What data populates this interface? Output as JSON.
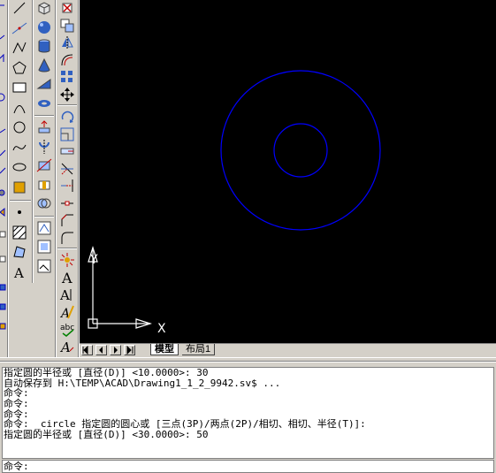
{
  "canvas": {
    "background": "#000000",
    "circle_color": "#0000ff",
    "ucs_color": "#ffffff",
    "ucs": {
      "x_label": "X",
      "y_label": "Y"
    }
  },
  "drawing": {
    "outer_circle_radius": 30,
    "inner_circle_radius": 10
  },
  "tabs": {
    "model": "模型",
    "layout1": "布局1"
  },
  "command": {
    "history": [
      "指定圆的半径或 [直径(D)] <10.0000>: 30",
      "自动保存到 H:\\TEMP\\ACAD\\Drawing1_1_2_9942.sv$ ...",
      "命令:",
      "命令:",
      "命令:",
      "命令: _circle 指定圆的圆心或 [三点(3P)/两点(2P)/相切、相切、半径(T)]:",
      "指定圆的半径或 [直径(D)] <30.0000>: 50"
    ],
    "prompt": "命令:"
  },
  "toolbars": {
    "draw": [
      "line-icon",
      "construction-line-icon",
      "polyline-icon",
      "polygon-icon",
      "rectangle-icon",
      "arc-icon",
      "circle-icon",
      "spline-icon",
      "ellipse-icon",
      "insert-block-icon",
      "point-icon",
      "hatch-icon",
      "region-icon",
      "text-icon"
    ],
    "modify": [
      "erase-icon",
      "copy-icon",
      "mirror-icon",
      "offset-icon",
      "array-icon",
      "move-icon",
      "rotate-icon",
      "scale-icon",
      "stretch-icon",
      "trim-icon",
      "extend-icon",
      "break-icon",
      "chamfer-icon",
      "fillet-icon",
      "explode-icon"
    ],
    "solids": [
      "box-icon",
      "sphere-icon",
      "cylinder-icon",
      "cone-icon",
      "wedge-icon",
      "torus-icon",
      "extrude-icon",
      "revolve-icon",
      "slice-icon",
      "section-icon",
      "interfere-icon",
      "setup-drawing-icon",
      "setup-view-icon",
      "setup-profile-icon"
    ],
    "text": [
      "multiline-text-icon",
      "single-line-text-icon",
      "edit-text-icon",
      "spell-check-icon",
      "text-style-icon"
    ]
  }
}
